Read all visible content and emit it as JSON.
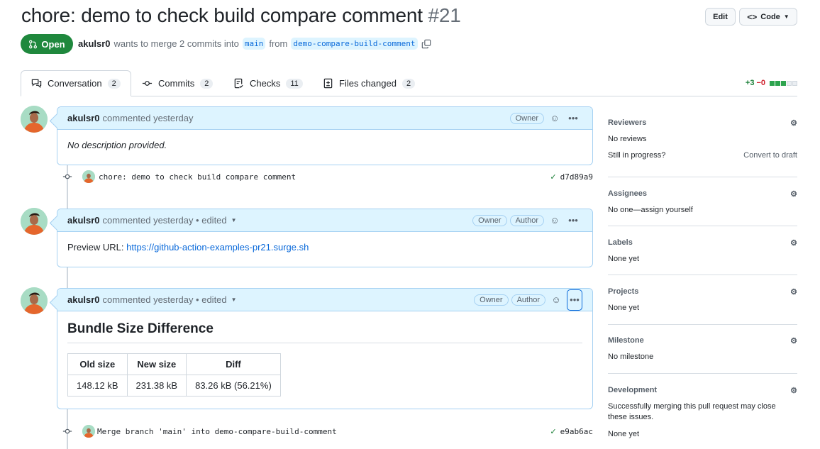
{
  "pr": {
    "title": "chore: demo to check build compare comment",
    "number": "#21",
    "state": "Open",
    "author": "akulsr0",
    "merge_text": "wants to merge 2 commits into",
    "base_branch": "main",
    "from_text": "from",
    "head_branch": "demo-compare-build-comment"
  },
  "header_buttons": {
    "edit": "Edit",
    "code": "Code"
  },
  "tabs": [
    {
      "label": "Conversation",
      "count": "2",
      "icon": "comment-discussion-icon"
    },
    {
      "label": "Commits",
      "count": "2",
      "icon": "git-commit-icon"
    },
    {
      "label": "Checks",
      "count": "11",
      "icon": "checklist-icon"
    },
    {
      "label": "Files changed",
      "count": "2",
      "icon": "file-diff-icon"
    }
  ],
  "diffstat": {
    "additions": "+3",
    "deletions": "−0",
    "blocks_added": 3,
    "blocks_total": 5
  },
  "comments": [
    {
      "author": "akulsr0",
      "meta": "commented yesterday",
      "badges": [
        "Owner"
      ],
      "body": "No description provided."
    },
    {
      "author": "akulsr0",
      "meta": "commented yesterday • edited",
      "badges": [
        "Owner",
        "Author"
      ],
      "body_label": "Preview URL:",
      "body_link": "https://github-action-examples-pr21.surge.sh"
    },
    {
      "author": "akulsr0",
      "meta": "commented yesterday • edited",
      "badges": [
        "Owner",
        "Author"
      ],
      "heading": "Bundle Size Difference",
      "table": {
        "headers": [
          "Old size",
          "New size",
          "Diff"
        ],
        "rows": [
          [
            "148.12 kB",
            "231.38 kB",
            "83.26 kB (56.21%)"
          ]
        ]
      }
    }
  ],
  "commits": [
    {
      "message": "chore: demo to check build compare comment",
      "sha": "d7d89a9",
      "status": "success"
    },
    {
      "message": "Merge branch 'main' into demo-compare-build-comment",
      "sha": "e9ab6ac",
      "status": "success"
    }
  ],
  "sidebar": {
    "reviewers": {
      "title": "Reviewers",
      "value": "No reviews",
      "progress_q": "Still in progress?",
      "convert": "Convert to draft"
    },
    "assignees": {
      "title": "Assignees",
      "value": "No one—assign yourself"
    },
    "labels": {
      "title": "Labels",
      "value": "None yet"
    },
    "projects": {
      "title": "Projects",
      "value": "None yet"
    },
    "milestone": {
      "title": "Milestone",
      "value": "No milestone"
    },
    "development": {
      "title": "Development",
      "desc": "Successfully merging this pull request may close these issues.",
      "value": "None yet"
    }
  }
}
